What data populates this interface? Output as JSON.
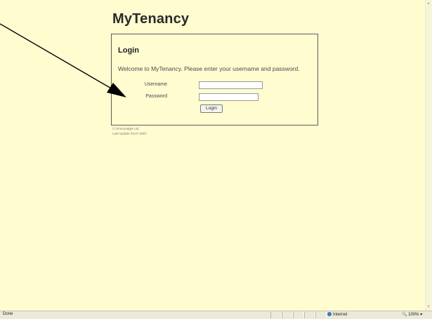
{
  "page": {
    "app_title": "MyTenancy",
    "login": {
      "heading": "Login",
      "welcome": "Welcome to MyTenancy. Please enter your username and password.",
      "username_label": "Username",
      "username_value": "",
      "password_label": "Password",
      "password_value": "",
      "button_label": "Login"
    },
    "footer": {
      "copyright": "© OmniLedger Ltd",
      "last_update": "Last Update 04.07.2007"
    }
  },
  "statusbar": {
    "status": "Done",
    "zone": "Internet",
    "zoom": "100%",
    "zoom_dropdown": "▾"
  },
  "annotation": {
    "icon": "arrow-icon",
    "color": "#000000"
  },
  "colors": {
    "page_background": "#fffcd0",
    "statusbar_background": "#ece9d8"
  }
}
